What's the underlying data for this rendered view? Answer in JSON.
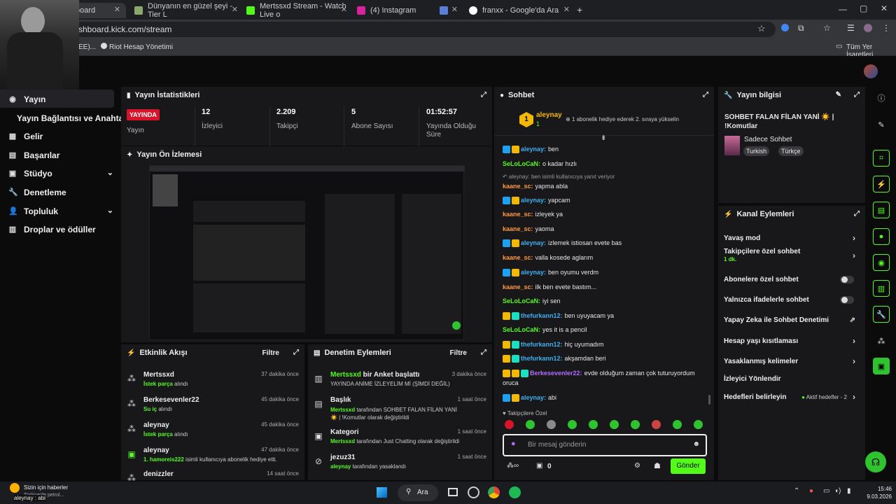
{
  "browser": {
    "tabs": [
      {
        "label": "board",
        "color": "#53fc18"
      },
      {
        "label": "Dünyanın en güzel şeyi - Tier L",
        "color": "#8ba86a"
      },
      {
        "label": "Mertssxd Stream - Watch Live o",
        "color": "#53fc18"
      },
      {
        "label": "(4) Instagram",
        "color": "#d6249f"
      },
      {
        "label": "",
        "color": "#5a7fd6"
      },
      {
        "label": "franxx - Google'da Ara",
        "color": "#ffffff"
      }
    ],
    "url": "shboard.kick.com/stream",
    "bookmarks": [
      "EE)...",
      "Riot Hesap Yönetimi"
    ],
    "all_bookmarks": "Tüm Yer İşaretleri"
  },
  "sidebar": {
    "items": [
      {
        "label": "Yayın",
        "icon": "broadcast-icon"
      },
      {
        "label": "Yayın Bağlantısı ve Anahtarı",
        "icon": ""
      },
      {
        "label": "Gelir",
        "icon": "revenue-icon"
      },
      {
        "label": "Başarılar",
        "icon": "achievements-icon"
      },
      {
        "label": "Stüdyo",
        "icon": "studio-icon"
      },
      {
        "label": "Denetleme",
        "icon": "moderation-icon"
      },
      {
        "label": "Topluluk",
        "icon": "community-icon"
      },
      {
        "label": "Droplar ve ödüller",
        "icon": "drops-icon"
      }
    ]
  },
  "stats": {
    "title": "Yayın İstatistikleri",
    "live_badge": "YAYINDA",
    "items": [
      {
        "value": "",
        "label": "Yayın"
      },
      {
        "value": "12",
        "label": "İzleyici"
      },
      {
        "value": "2.209",
        "label": "Takipçi"
      },
      {
        "value": "5",
        "label": "Abone Sayısı"
      },
      {
        "value": "01:52:57",
        "label": "Yayında Olduğu Süre"
      }
    ]
  },
  "preview": {
    "title": "Yayın Ön İzlemesi"
  },
  "activity": {
    "title": "Etkinlik Akışı",
    "filter": "Filtre",
    "rows": [
      {
        "name": "Mertssxd",
        "action_hl": "İstek parça",
        "action": " alındı",
        "time": "37 dakika önce"
      },
      {
        "name": "Berkesevenler22",
        "action_hl": "Su iç",
        "action": " alındı",
        "time": "45 dakika önce"
      },
      {
        "name": "aleynay",
        "action_hl": "İstek parça",
        "action": " alındı",
        "time": "45 dakika önce"
      },
      {
        "name": "aleynay",
        "action_hl": "1. hamoreis222",
        "action": " isimli kullanıcıya abonelik hediye etti.",
        "time": "47 dakika önce"
      },
      {
        "name": "denizzler",
        "action_hl": "",
        "action": "",
        "time": "14 saat önce"
      }
    ]
  },
  "moderation": {
    "title": "Denetim Eylemleri",
    "filter": "Filtre",
    "rows": [
      {
        "title_hl": "Mertssxd",
        "title": " bir Anket başlattı",
        "detail": "YAYINDA ANİME İZLEYELİM Mİ (ŞİMDİ DEĞİL)",
        "time": "3 dakika önce"
      },
      {
        "title_hl": "",
        "title": "Başlık",
        "detail_hl": "Mertssxd",
        "detail": " tarafından SOHBET FALAN FİLAN YANİ ☀️ | !Komutlar olarak değiştirildi",
        "time": "1 saat önce"
      },
      {
        "title_hl": "",
        "title": "Kategori",
        "detail_hl": "Mertssxd",
        "detail": " tarafından Just Chatting olarak değiştirildi",
        "time": "1 saat önce"
      },
      {
        "title_hl": "",
        "title": "jezuz31",
        "detail_hl": "aleynay",
        "detail": " tarafından yasaklandı",
        "time": "1 saat önce"
      }
    ]
  },
  "chat": {
    "title": "Sohbet",
    "pinned_user": "aleynay",
    "pinned_count": "1",
    "pinned_rank": "1",
    "pinned_text": "1 abonelik hediye ederek 2. sıraya yükselin",
    "messages": [
      {
        "user": "aleynay",
        "color": "#3ab0f0",
        "text": "ben",
        "badges": [
          "blue",
          "crown"
        ]
      },
      {
        "user": "SeLoLoCaN",
        "color": "#53fc18",
        "text": "o kadar hızlı",
        "badges": []
      },
      {
        "user": "",
        "color": "#aaaaaa",
        "text": "aleynay: ben isimli kullanıcıya yanıt veriyor",
        "badges": [],
        "reply": true
      },
      {
        "user": "kaane_sc",
        "color": "#ff9a3c",
        "text": "yapma abla",
        "badges": []
      },
      {
        "user": "aleynay",
        "color": "#3ab0f0",
        "text": "yapcam",
        "badges": [
          "blue",
          "crown"
        ]
      },
      {
        "user": "kaane_sc",
        "color": "#ff9a3c",
        "text": "izleyek ya",
        "badges": []
      },
      {
        "user": "kaane_sc",
        "color": "#ff9a3c",
        "text": "yaoma",
        "badges": []
      },
      {
        "user": "aleynay",
        "color": "#3ab0f0",
        "text": "izlemek istiosan evete bas",
        "badges": [
          "blue",
          "crown"
        ]
      },
      {
        "user": "kaane_sc",
        "color": "#ff9a3c",
        "text": "valla kosede aglarım",
        "badges": []
      },
      {
        "user": "aleynay",
        "color": "#3ab0f0",
        "text": "ben oyumu verdm",
        "badges": [
          "blue",
          "crown"
        ]
      },
      {
        "user": "kaane_sc",
        "color": "#ff9a3c",
        "text": "ilk ben evete bastım...",
        "badges": []
      },
      {
        "user": "SeLoLoCaN",
        "color": "#53fc18",
        "text": "iyi sen",
        "badges": []
      },
      {
        "user": "thefurkann12",
        "color": "#3ab0f0",
        "text": "ben uyuyacam ya",
        "badges": [
          "crown",
          "green"
        ]
      },
      {
        "user": "SeLoLoCaN",
        "color": "#53fc18",
        "text": "yes it is a pencil",
        "badges": []
      },
      {
        "user": "thefurkann12",
        "color": "#3ab0f0",
        "text": "hiç uyumadım",
        "badges": [
          "crown",
          "green"
        ]
      },
      {
        "user": "thefurkann12",
        "color": "#3ab0f0",
        "text": "akşamdan beri",
        "badges": [
          "crown",
          "green"
        ]
      },
      {
        "user": "Berkesevenler22",
        "color": "#b36bff",
        "text": "evde olduğum zaman çok tuturuyordum",
        "badges": [
          "crown",
          "crown",
          "green"
        ]
      },
      {
        "user": "",
        "color": "#e8e8e8",
        "text": "oruca",
        "badges": []
      },
      {
        "user": "aleynay",
        "color": "#3ab0f0",
        "text": "abi",
        "badges": [
          "blue",
          "crown"
        ]
      }
    ],
    "followers_only": "Takipçilere Özel",
    "input_placeholder": "Bir mesaj gönderin",
    "send": "Gönder",
    "points": "0"
  },
  "stream_info": {
    "title": "Yayın bilgisi",
    "stream_title": "SOHBET FALAN FİLAN YANİ ☀️ | !Komutlar",
    "category": "Sadece Sohbet",
    "tags": [
      "Turkish",
      "Türkçe"
    ]
  },
  "channel_actions": {
    "title": "Kanal Eylemleri",
    "items": [
      {
        "label": "Yavaş mod",
        "control": "arrow",
        "sub": ""
      },
      {
        "label": "Takipçilere özel sohbet",
        "control": "arrow",
        "sub": "1 dk."
      },
      {
        "label": "Abonelere özel sohbet",
        "control": "toggle",
        "sub": ""
      },
      {
        "label": "Yalnızca ifadelerle sohbet",
        "control": "toggle",
        "sub": ""
      },
      {
        "label": "Yapay Zeka ile Sohbet Denetimi",
        "control": "external",
        "sub": ""
      },
      {
        "label": "Hesap yaşı kısıtlaması",
        "control": "arrow",
        "sub": ""
      },
      {
        "label": "Yasaklanmış kelimeler",
        "control": "arrow",
        "sub": ""
      },
      {
        "label": "İzleyici Yönlendir",
        "control": "",
        "sub": ""
      },
      {
        "label": "Hedefleri belirleyin",
        "control": "arrow",
        "sub": "",
        "extra": "Aktif hedefler - 2"
      }
    ]
  },
  "taskbar": {
    "news_title": "Sizin için haberler",
    "news_sub": "Türkiye'de petrol...",
    "search": "Ara",
    "time": "15:46",
    "date": "9.03.2026",
    "bottom_chat": "aleynay : abi"
  }
}
